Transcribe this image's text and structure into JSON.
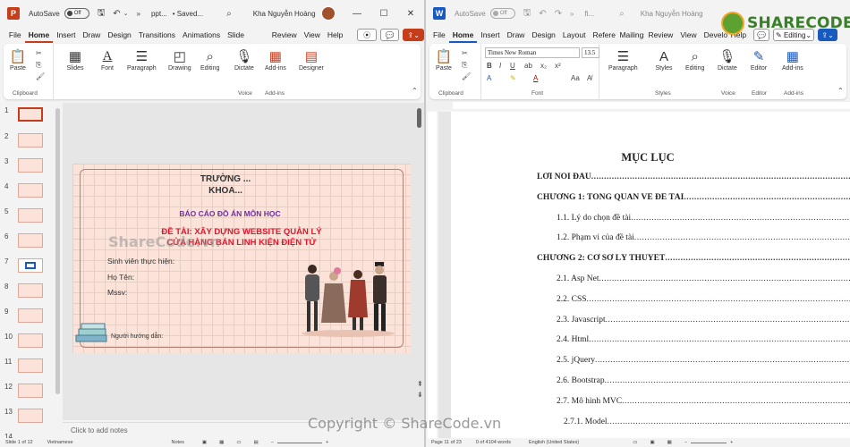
{
  "ppt": {
    "autosave_label": "AutoSave",
    "autosave_state": "Off",
    "doc_title": "ppt...",
    "saved_status": "• Saved...",
    "user_name": "Kha Nguyễn Hoàng",
    "menu": [
      "File",
      "Home",
      "Insert",
      "Draw",
      "Design",
      "Transitions",
      "Animations",
      "Slide Show",
      "Review",
      "View",
      "Help"
    ],
    "ribbon": {
      "paste": "Paste",
      "clipboard": "Clipboard",
      "slides": "Slides",
      "font": "Font",
      "paragraph": "Paragraph",
      "drawing": "Drawing",
      "editing": "Editing",
      "dictate": "Dictate",
      "voice": "Voice",
      "addins": "Add-ins",
      "addins_group": "Add-ins",
      "designer": "Designer"
    },
    "slide_numbers": [
      "1",
      "2",
      "3",
      "4",
      "5",
      "6",
      "7",
      "8",
      "9",
      "10",
      "11",
      "12",
      "13",
      "14"
    ],
    "slide": {
      "school": "TRƯỜNG ...",
      "faculty": "KHOA...",
      "report": "BÁO CÁO ĐỒ ÁN MÔN HỌC",
      "topic_line1": "ĐỀ TÀI: XÂY DỰNG WEBSITE QUẢN LÝ",
      "topic_line2": "CỬA HÀNG BÁN LINH KIỆN ĐIỆN TỬ",
      "student": "Sinh viên thực hiện:",
      "fullname": "Họ Tên:",
      "mssv": "Mssv:",
      "advisor": "Người hướng dẫn:"
    },
    "notes_placeholder": "Click to add notes",
    "status": {
      "slide_count": "Slide 1 of 12",
      "language": "Vietnamese",
      "notes": "Notes"
    },
    "watermark": "ShareCode.vn"
  },
  "word": {
    "autosave_label": "AutoSave",
    "autosave_state": "Off",
    "doc_title": "fi...",
    "user_name": "Kha Nguyễn Hoàng",
    "menu": [
      "File",
      "Home",
      "Insert",
      "Draw",
      "Design",
      "Layout",
      "References",
      "Mailings",
      "Review",
      "View",
      "Developer",
      "Help"
    ],
    "editing_mode": "Editing",
    "ribbon": {
      "paste": "Paste",
      "clipboard": "Clipboard",
      "font_name": "Times New Roman",
      "font_size": "13.5",
      "font": "Font",
      "paragraph": "Paragraph",
      "styles": "Styles",
      "editing": "Editing",
      "dictate": "Dictate",
      "voice": "Voice",
      "editor": "Editor",
      "addins": "Add-ins",
      "addins_group": "Add-ins"
    },
    "toc": {
      "title": "MỤC LỤC",
      "entries": [
        {
          "text": "LỜI NÓI ĐẦU",
          "level": 0
        },
        {
          "text": "CHƯƠNG 1: TỔNG QUAN VỀ ĐỀ TÀI",
          "level": 0
        },
        {
          "text": "1.1. Lý do chọn đề tài",
          "level": 1
        },
        {
          "text": "1.2. Phạm vi của đề tài",
          "level": 1
        },
        {
          "text": "CHƯƠNG 2: CƠ SỞ LÝ THUYẾT",
          "level": 0
        },
        {
          "text": "2.1. Asp Net",
          "level": 1
        },
        {
          "text": "2.2. CSS",
          "level": 1
        },
        {
          "text": "2.3. Javascript",
          "level": 1
        },
        {
          "text": "2.4. Html",
          "level": 1
        },
        {
          "text": "2.5. jQuery",
          "level": 1
        },
        {
          "text": "2.6. Bootstrap",
          "level": 1
        },
        {
          "text": "2.7. Mô hình MVC",
          "level": 1
        },
        {
          "text": "2.7.1. Model",
          "level": 2
        }
      ]
    },
    "status": {
      "page": "Page 11 of 23",
      "words": "0 of 4104 words",
      "language": "English (United States)"
    }
  },
  "watermarks": {
    "logo_text": "SHARECODE.vn",
    "copyright": "Copyright © ShareCode.vn"
  },
  "colors": {
    "ppt_accent": "#c43e1c",
    "word_accent": "#185abd",
    "slide_purple": "#7030a0",
    "slide_red": "#e0162b"
  }
}
